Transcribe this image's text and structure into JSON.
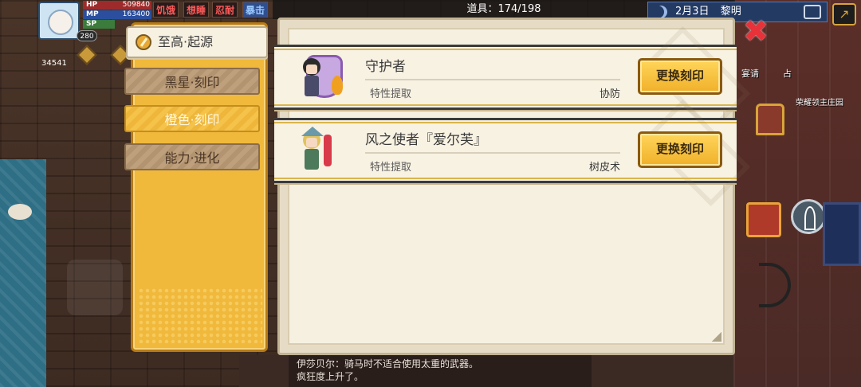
{
  "hud": {
    "hp_label": "HP",
    "hp_value": "509840",
    "mp_label": "MP",
    "mp_value": "163400",
    "sp_label": "SP",
    "level": "280",
    "gold": "34541",
    "status_hunger": "饥饿",
    "status_sleepy": "想睡",
    "status_tolerance": "忍耐",
    "status_crit": "暴击",
    "items_label": "道具：174/198",
    "date": "2月3日",
    "time_of_day": "黎明"
  },
  "tabs": [
    {
      "label": "至高·起源",
      "active": true
    },
    {
      "label": "黑星·刻印",
      "active": false
    },
    {
      "label": "橙色·刻印",
      "active": false
    },
    {
      "label": "能力·进化",
      "active": false
    }
  ],
  "items": [
    {
      "name": "守护者",
      "trait_label": "特性提取",
      "trait_value": "协防",
      "button": "更换刻印"
    },
    {
      "name": "风之使者『爱尔芙』",
      "trait_label": "特性提取",
      "trait_value": "树皮术",
      "button": "更换刻印"
    }
  ],
  "chat": {
    "line1": "伊莎贝尔：骑马时不适合使用太重的武器。",
    "line2": "疯狂度上升了。"
  },
  "map": {
    "invite": "宴请",
    "occupy": "占",
    "manor": "荣耀领主庄园"
  },
  "icons": {
    "close": "close-icon",
    "exit": "exit-icon",
    "network": "network-icon",
    "moon": "moon-icon",
    "compass": "compass-icon",
    "bow": "bow-icon",
    "origin": "origin-tab-icon"
  },
  "colors": {
    "tab_panel": "#f0b93c",
    "button": "#f0b02a",
    "close": "#e8323a"
  }
}
